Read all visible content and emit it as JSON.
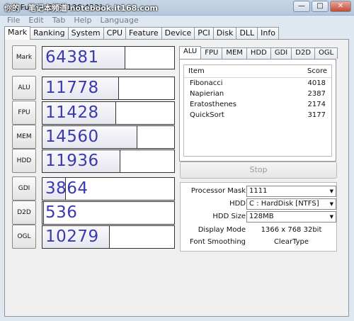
{
  "window": {
    "title": "Q... Fu... ... [0.9.136.452]",
    "watermark": "你的 · 笔记本频道 notebook.it168.com",
    "minimize_icon": "minimize-icon",
    "maximize_icon": "maximize-icon",
    "close_icon": "close-icon"
  },
  "menu": [
    "File",
    "Edit",
    "Tab",
    "Help",
    "Language"
  ],
  "tabs": [
    "Mark",
    "Ranking",
    "System",
    "CPU",
    "Feature",
    "Device",
    "PCI",
    "Disk",
    "DLL",
    "Info"
  ],
  "scores": [
    {
      "label": "Mark",
      "value": "64381",
      "fill": 0.63
    },
    {
      "label": "ALU",
      "value": "11778",
      "fill": 0.58
    },
    {
      "label": "FPU",
      "value": "11428",
      "fill": 0.56
    },
    {
      "label": "MEM",
      "value": "14560",
      "fill": 0.72
    },
    {
      "label": "HDD",
      "value": "11936",
      "fill": 0.59
    },
    {
      "label": "GDI",
      "value": "3864",
      "fill": 0.18
    },
    {
      "label": "D2D",
      "value": "536",
      "fill": 0.01
    },
    {
      "label": "OGL",
      "value": "10279",
      "fill": 0.51
    }
  ],
  "detail_tabs": [
    "ALU",
    "FPU",
    "MEM",
    "HDD",
    "GDI",
    "D2D",
    "OGL"
  ],
  "detail": {
    "col_item": "Item",
    "col_score": "Score",
    "rows": [
      {
        "item": "Fibonacci",
        "score": "4018"
      },
      {
        "item": "Napierian",
        "score": "2387"
      },
      {
        "item": "Eratosthenes",
        "score": "2174"
      },
      {
        "item": "QuickSort",
        "score": "3177"
      }
    ]
  },
  "stop_label": "Stop",
  "settings": {
    "processor_mask_label": "Processor Mask",
    "processor_mask_value": "1111",
    "hdd_label": "HDD",
    "hdd_value": "C : HardDisk [NTFS]",
    "hdd_size_label": "HDD Size",
    "hdd_size_value": "128MB",
    "display_mode_label": "Display Mode",
    "display_mode_value": "1366 x 768 32bit",
    "font_smoothing_label": "Font Smoothing",
    "font_smoothing_value": "ClearType"
  }
}
